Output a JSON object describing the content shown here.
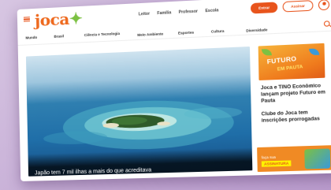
{
  "header": {
    "logo_main": "joca",
    "logo_dot": "✦",
    "links": [
      "Leitor",
      "Família",
      "Professor",
      "Escola"
    ],
    "login_label": "Entrar",
    "subscribe_label": "Assinar"
  },
  "nav": {
    "items": [
      "Mundo",
      "Brasil",
      "Ciência e Tecnologia",
      "Meio Ambiente",
      "Esportes",
      "Cultura",
      "Diversidade"
    ]
  },
  "hero": {
    "caption": "Japão tem 7 mil ilhas a mais do que acreditava"
  },
  "sidebar": {
    "promo_title": "FUTURO",
    "promo_sub": "EM PAUTA",
    "news": [
      "Joca e TINO Econômico lançam projeto Futuro em Pauta",
      "Clube do Joca tem inscrições prorrogadas"
    ],
    "banner_label": "faça sua",
    "banner_cta": "ASSINATURA"
  },
  "colors": {
    "brand": "#e8541c",
    "logo": "#ee6a1f",
    "accent_green": "#7cc142"
  }
}
